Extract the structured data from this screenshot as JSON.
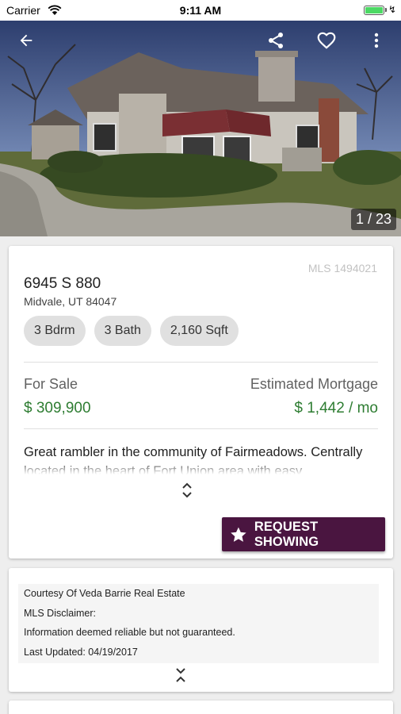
{
  "status_bar": {
    "carrier": "Carrier",
    "time": "9:11 AM",
    "battery_level": 1.0,
    "battery_color": "#4cd964",
    "charging_icon": "↯"
  },
  "photo": {
    "counter": "1 / 23",
    "icons": [
      "back-arrow-icon",
      "share-icon",
      "heart-icon",
      "more-vertical-icon"
    ]
  },
  "listing": {
    "mls": "MLS 1494021",
    "address_line1": "6945 S 880",
    "address_line2": "Midvale, UT 84047",
    "chips": [
      {
        "label": "3 Bdrm"
      },
      {
        "label": "3 Bath"
      },
      {
        "label": "2,160 Sqft"
      }
    ],
    "status_label": "For Sale",
    "price": "$ 309,900",
    "mortgage_label": "Estimated Mortgage",
    "mortgage_value": "$ 1,442 / mo",
    "description": "Great rambler in the community of Fairmeadows. Centrally located in the heart of Fort Union area with easy",
    "request_button": "REQUEST SHOWING",
    "price_color": "#2e7d32",
    "button_color": "#4a1540"
  },
  "disclaimer": {
    "lines": [
      "Courtesy Of Veda Barrie Real Estate",
      "MLS Disclaimer:",
      "Information deemed reliable but not guaranteed.",
      "Last Updated: 04/19/2017"
    ]
  }
}
